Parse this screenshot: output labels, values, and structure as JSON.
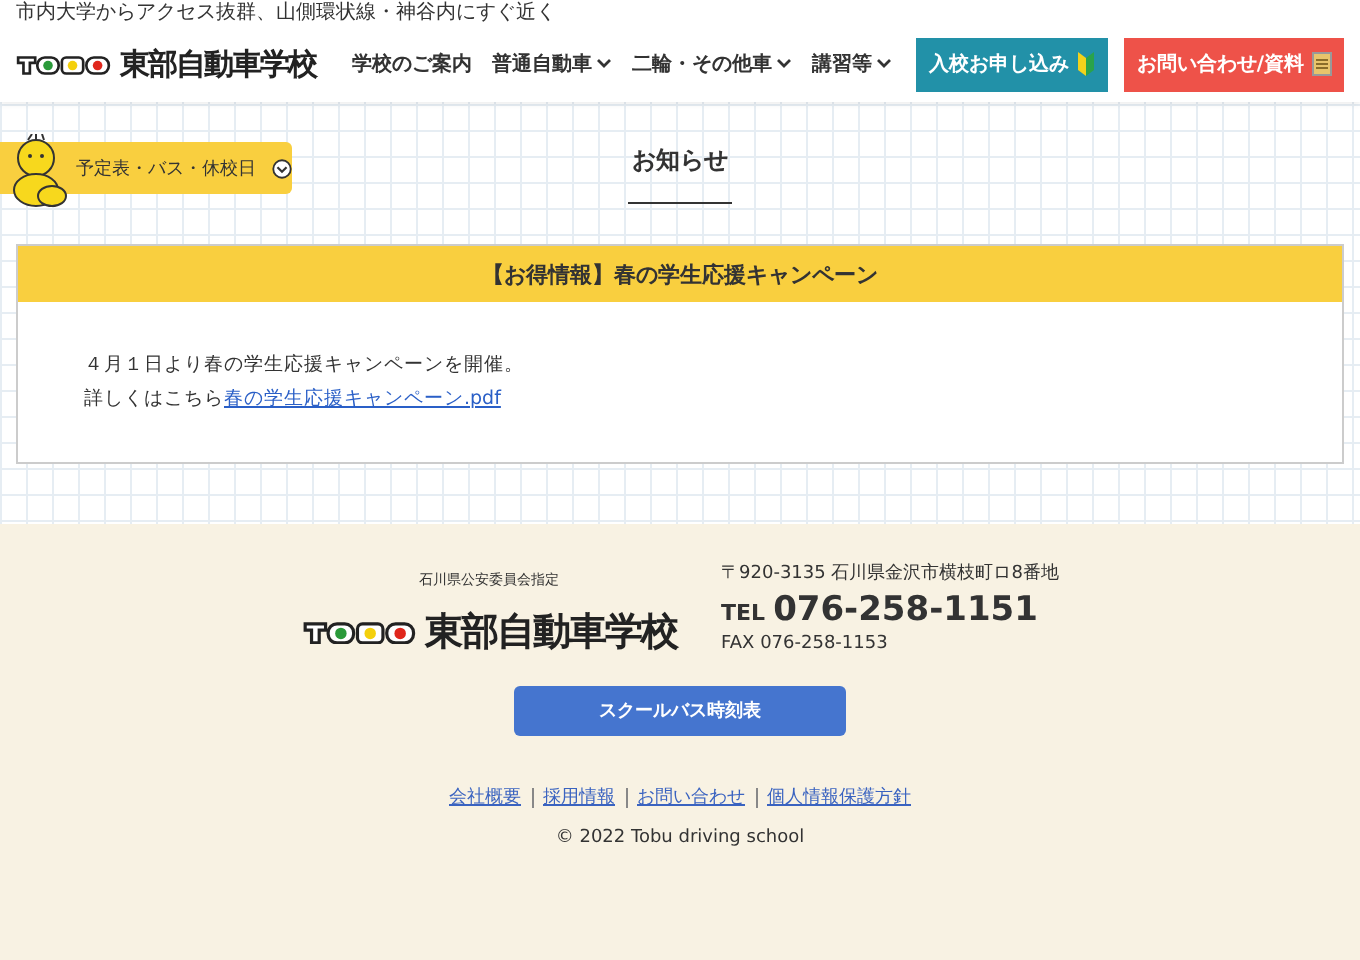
{
  "header": {
    "tagline": "市内大学からアクセス抜群、山側環状線・神谷内にすぐ近く",
    "logo_text": "東部自動車学校",
    "nav": [
      {
        "label": "学校のご案内",
        "dropdown": false
      },
      {
        "label": "普通自動車",
        "dropdown": true
      },
      {
        "label": "二輪・その他車",
        "dropdown": true
      },
      {
        "label": "講習等",
        "dropdown": true
      }
    ],
    "buttons": [
      {
        "label": "入校お申し込み",
        "kind": "apply"
      },
      {
        "label": "お問い合わせ/資料",
        "kind": "contact"
      }
    ]
  },
  "schedule_tab": {
    "label": "予定表・バス・休校日",
    "expanded": false
  },
  "page_title": "お知らせ",
  "notice": {
    "title": "【お得情報】春の学生応援キャンペーン",
    "lines": [
      "４月１日より春の学生応援キャンペーンを開催。"
    ],
    "link_prefix": "詳しくはこちら",
    "link": "春の学生応援キャンペーン.pdf"
  },
  "footer": {
    "designation": "石川県公安委員会指定",
    "logo_text": "東部自動車学校",
    "address": "〒920-3135 石川県金沢市横枝町ロ8番地",
    "tel_label": "TEL",
    "tel": "076-258-1151",
    "fax": "FAX 076-258-1153",
    "bus_button": "スクールバス時刻表",
    "links": [
      "会社概要",
      "採用情報",
      "お問い合わせ",
      "個人情報保護方針"
    ],
    "copyright": "© 2022 Tobu driving school"
  }
}
